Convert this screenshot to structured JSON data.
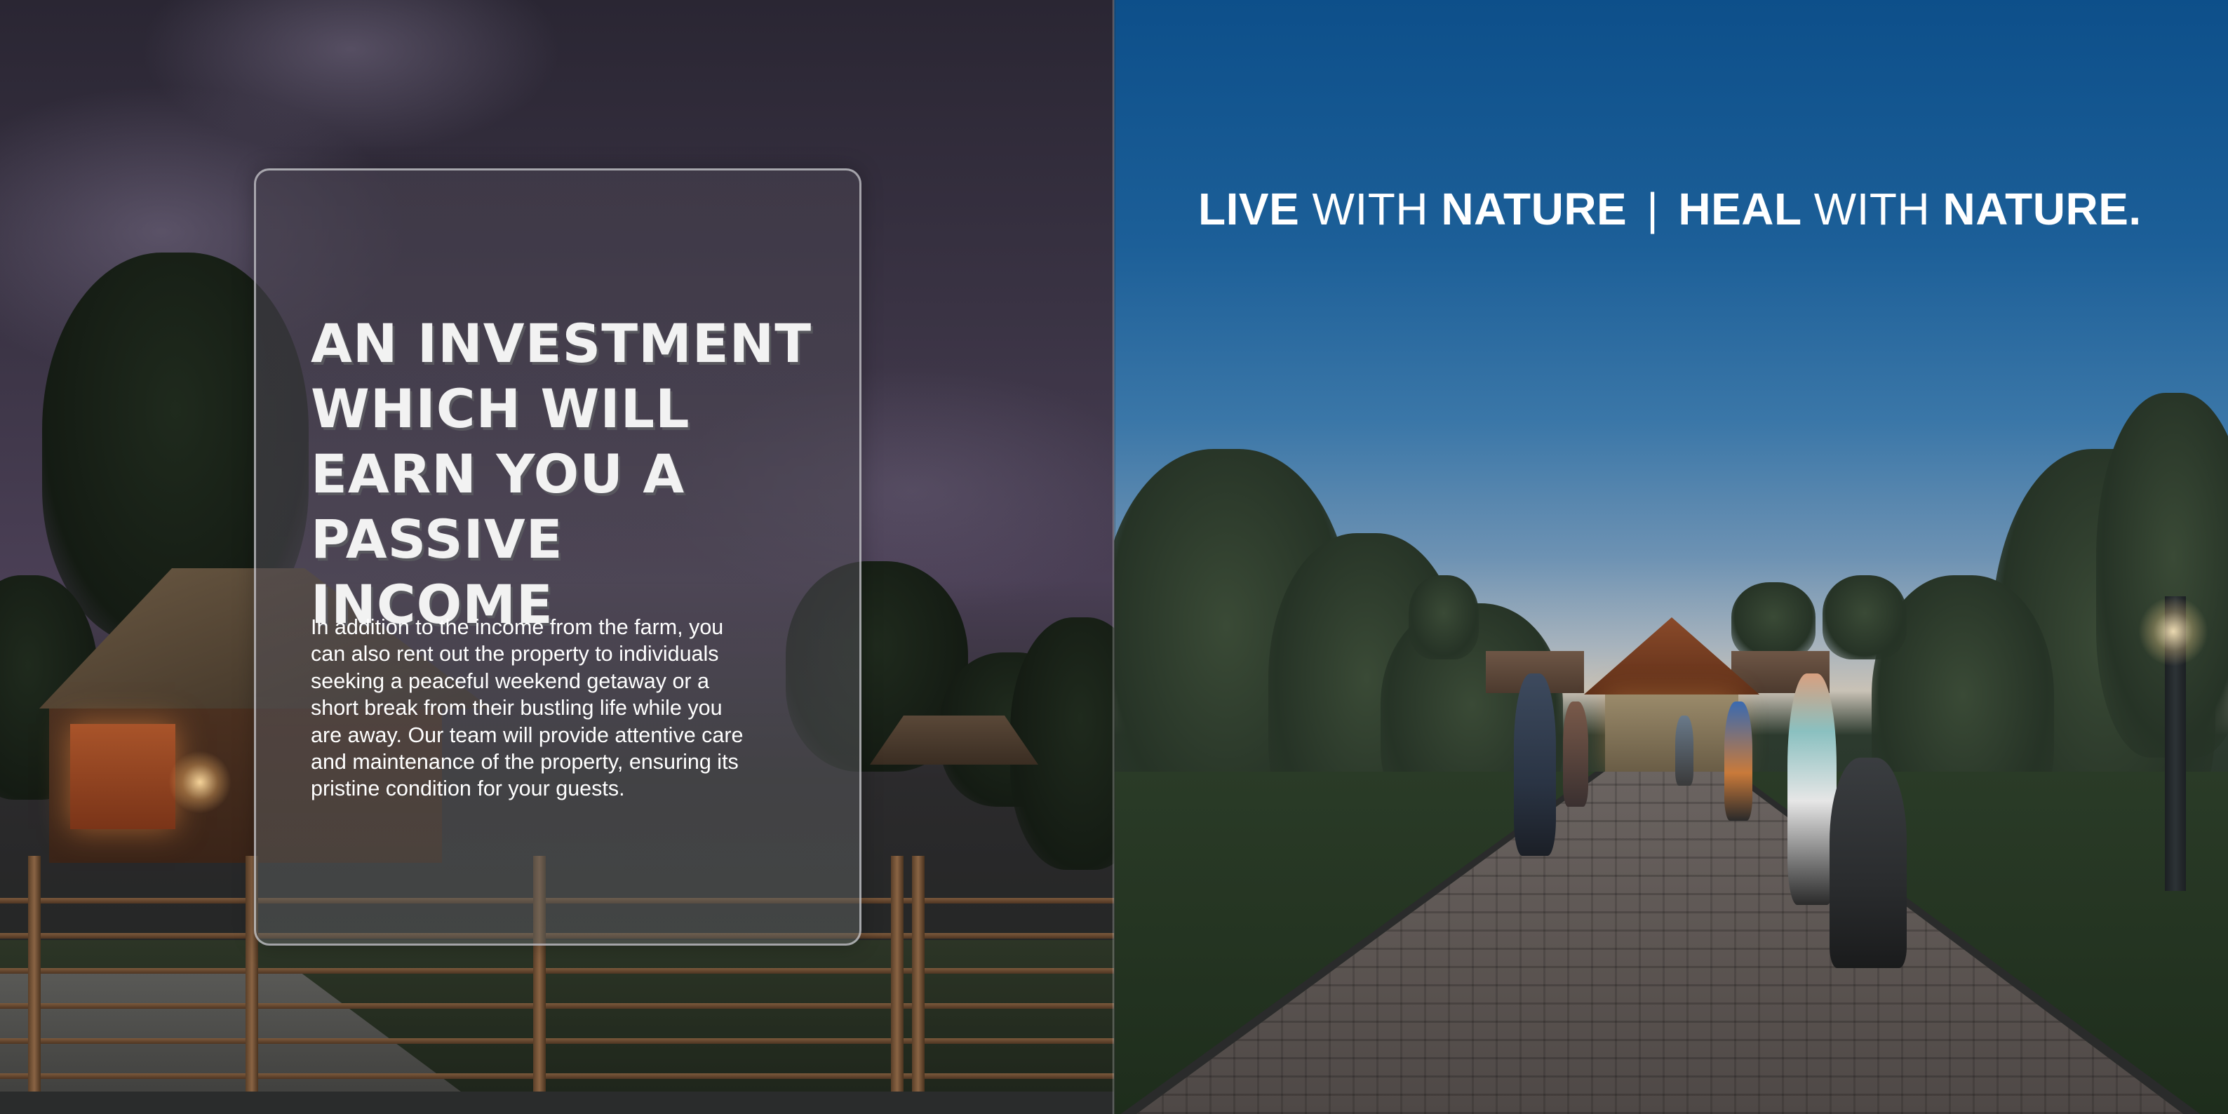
{
  "left_page": {
    "headline_lines": [
      "AN INVESTMENT",
      "WHICH WILL",
      "EARN YOU A",
      "PASSIVE INCOME"
    ],
    "body_lines": [
      "In addition to the income from the farm, you",
      "can also rent out the property to individuals",
      "seeking a peaceful weekend getaway or a",
      "short break from their bustling life while you",
      "are away. Our team will provide attentive care",
      "and maintenance of the property, ensuring its",
      "pristine condition for your guests."
    ],
    "text_color": "#ffffff"
  },
  "right_page": {
    "tagline": {
      "word1": "LIVE",
      "with1": "WITH",
      "word2": "NATURE",
      "separator": "|",
      "word3": "HEAL",
      "with2": "WITH",
      "word4": "NATURE."
    },
    "sky_color": "#0d4f8a"
  }
}
